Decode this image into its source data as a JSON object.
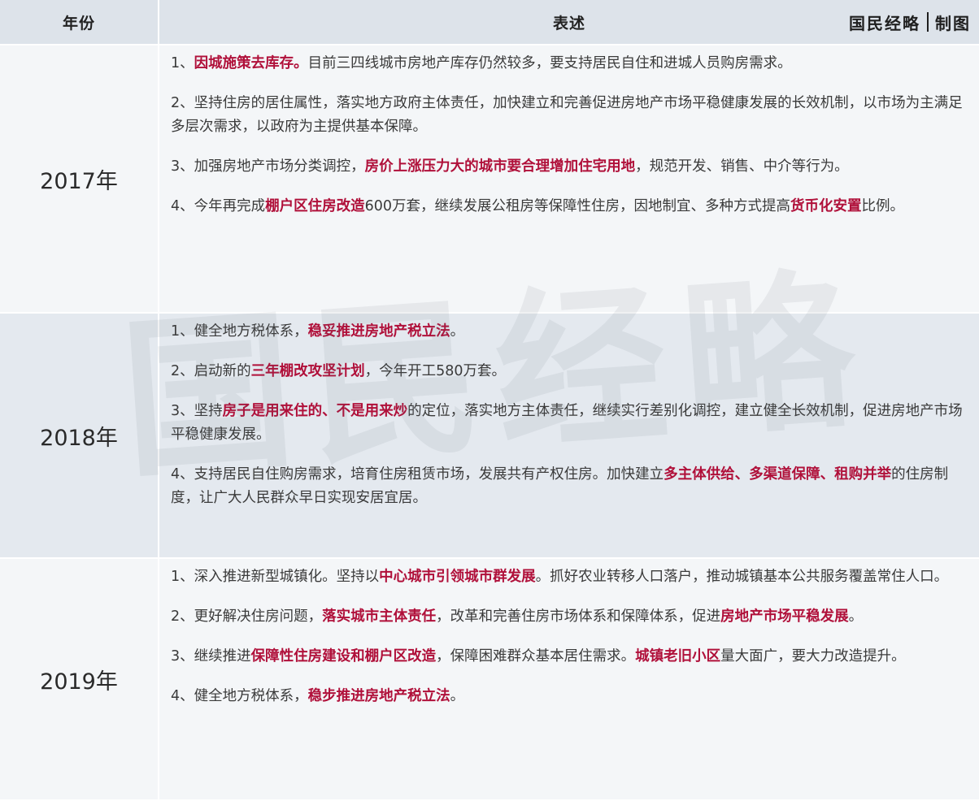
{
  "header": {
    "year_col": "年份",
    "desc_col": "表述",
    "credit_left": "国民经略",
    "credit_right": "制图"
  },
  "watermark": "国民经略",
  "colors": {
    "highlight": "#b0103a",
    "header_bg": "#dde3ea",
    "band_light": "#f4f6f8",
    "band_mid": "#e4e9ef"
  },
  "rows": [
    {
      "year": "2017年",
      "items": [
        [
          "1、",
          {
            "hl": "因城施策去库存。"
          },
          "目前三四线城市房地产库存仍然较多，要支持居民自住和进城人员购房需求。"
        ],
        [
          "2、坚持住房的居住属性，落实地方政府主体责任，加快建立和完善促进房地产市场平稳健康发展的长效机制，以市场为主满足多层次需求，以政府为主提供基本保障。"
        ],
        [
          "3、加强房地产市场分类调控，",
          {
            "hl": "房价上涨压力大的城市要合理增加住宅用地"
          },
          "，规范开发、销售、中介等行为。"
        ],
        [
          "4、今年再完成",
          {
            "hl": "棚户区住房改造"
          },
          "600万套，继续发展公租房等保障性住房，因地制宜、多种方式提高",
          {
            "hl": "货币化安置"
          },
          "比例。"
        ]
      ]
    },
    {
      "year": "2018年",
      "items": [
        [
          "1、健全地方税体系，",
          {
            "hl": "稳妥推进房地产税立法"
          },
          "。"
        ],
        [
          "2、启动新的",
          {
            "hl": "三年棚改攻坚计划"
          },
          "，今年开工580万套。"
        ],
        [
          "3、坚持",
          {
            "hl": "房子是用来住的、不是用来炒"
          },
          "的定位，落实地方主体责任，继续实行差别化调控，建立健全长效机制，促进房地产市场平稳健康发展。"
        ],
        [
          "4、支持居民自住购房需求，培育住房租赁市场，发展共有产权住房。加快建立",
          {
            "hl": "多主体供给、多渠道保障、租购并举"
          },
          "的住房制度，让广大人民群众早日实现安居宜居。"
        ]
      ]
    },
    {
      "year": "2019年",
      "items": [
        [
          "1、深入推进新型城镇化。坚持以",
          {
            "hl": "中心城市引领城市群发展"
          },
          "。抓好农业转移人口落户，推动城镇基本公共服务覆盖常住人口。"
        ],
        [
          "2、更好解决住房问题，",
          {
            "hl": "落实城市主体责任"
          },
          "，改革和完善住房市场体系和保障体系，促进",
          {
            "hl": "房地产市场平稳发展"
          },
          "。"
        ],
        [
          "3、继续推进",
          {
            "hl": "保障性住房建设和棚户区改造"
          },
          "，保障困难群众基本居住需求。",
          {
            "hl": "城镇老旧小区"
          },
          "量大面广，要大力改造提升。"
        ],
        [
          "4、健全地方税体系，",
          {
            "hl": "稳步推进房地产税立法"
          },
          "。"
        ]
      ]
    }
  ]
}
